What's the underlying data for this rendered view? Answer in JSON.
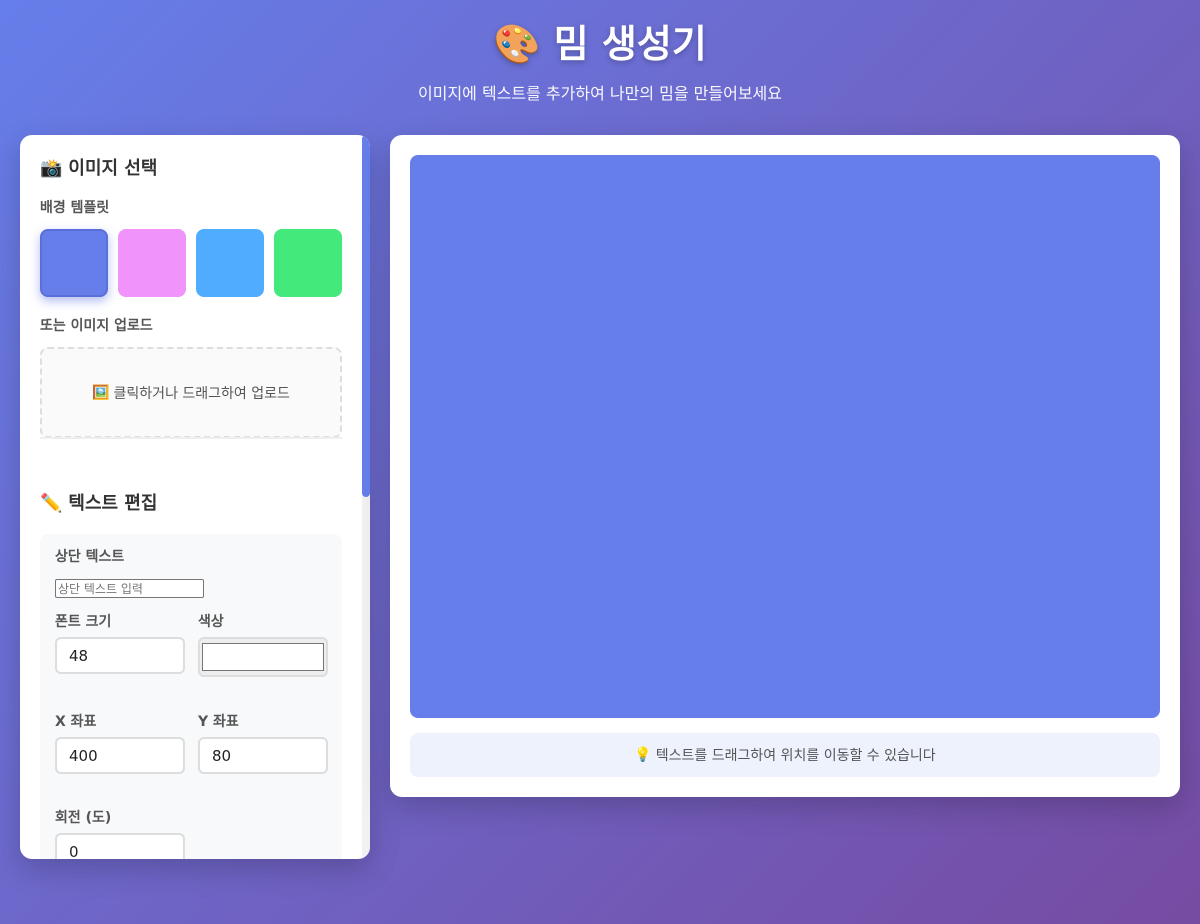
{
  "header": {
    "emoji": "🎨",
    "title": "밈 생성기",
    "subtitle": "이미지에 텍스트를 추가하여 나만의 밈을 만들어보세요"
  },
  "image_section": {
    "emoji": "📸",
    "title": "이미지 선택",
    "templates_label": "배경 템플릿",
    "templates": [
      {
        "color": "#667eea",
        "selected": true
      },
      {
        "color": "#f093fb",
        "selected": false
      },
      {
        "color": "#4facfe",
        "selected": false
      },
      {
        "color": "#43e97b",
        "selected": false
      }
    ],
    "upload_label": "또는 이미지 업로드",
    "upload_emoji": "🖼️",
    "upload_text": "클릭하거나 드래그하여 업로드"
  },
  "text_section": {
    "emoji": "✏️",
    "title": "텍스트 편집",
    "top_text_label": "상단 텍스트",
    "top_text_placeholder": "상단 텍스트 입력",
    "top_text_value": "",
    "font_size_label": "폰트 크기",
    "font_size_value": "48",
    "color_label": "색상",
    "color_value": "#ffffff",
    "x_label": "X 좌표",
    "x_value": "400",
    "y_label": "Y 좌표",
    "y_value": "80",
    "rotation_label": "회전 (도)",
    "rotation_value": "0"
  },
  "canvas": {
    "background": "#667eea"
  },
  "hint": {
    "emoji": "💡",
    "text": "텍스트를 드래그하여 위치를 이동할 수 있습니다"
  }
}
